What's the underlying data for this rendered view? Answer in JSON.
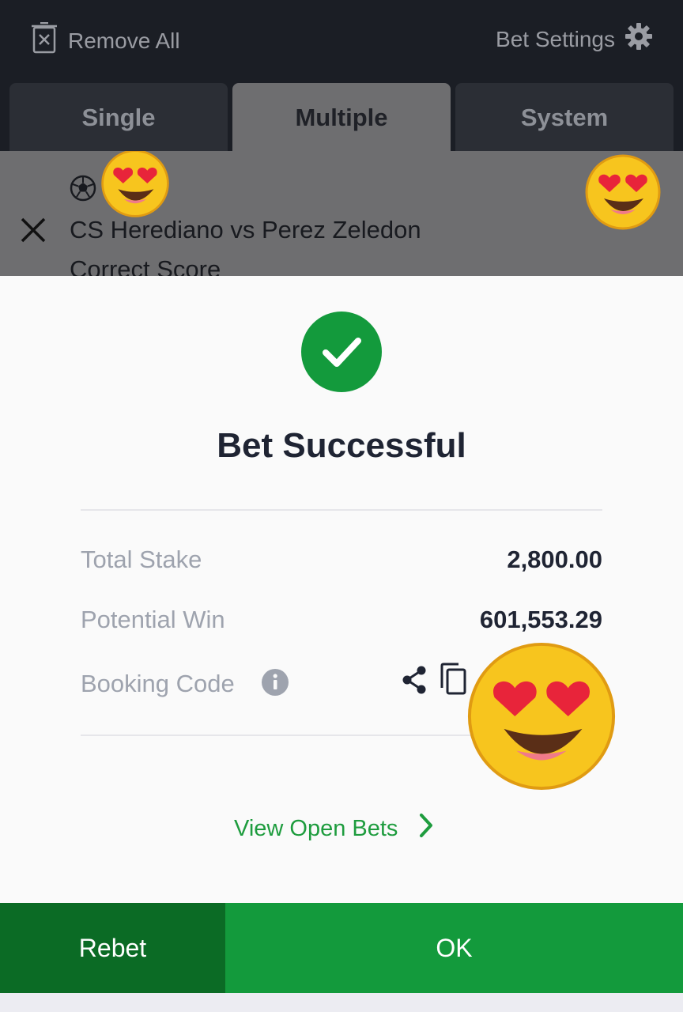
{
  "header": {
    "remove_all_label": "Remove All",
    "bet_settings_label": "Bet Settings"
  },
  "tabs": [
    {
      "label": "Single",
      "active": false
    },
    {
      "label": "Multiple",
      "active": true
    },
    {
      "label": "System",
      "active": false
    }
  ],
  "selection": {
    "sport_icon": "soccer-ball-icon",
    "match": "CS Herediano vs Perez Zeledon",
    "market": "Correct Score"
  },
  "modal": {
    "title": "Bet Successful",
    "total_stake_label": "Total Stake",
    "total_stake_value": "2,800.00",
    "potential_win_label": "Potential Win",
    "potential_win_value": "601,553.29",
    "booking_code_label": "Booking Code",
    "view_open_bets_label": "View Open Bets"
  },
  "buttons": {
    "rebet_label": "Rebet",
    "ok_label": "OK"
  },
  "colors": {
    "success_green": "#139a3c",
    "dark_green": "#0b6b25",
    "header_bg": "#1b1e25"
  }
}
